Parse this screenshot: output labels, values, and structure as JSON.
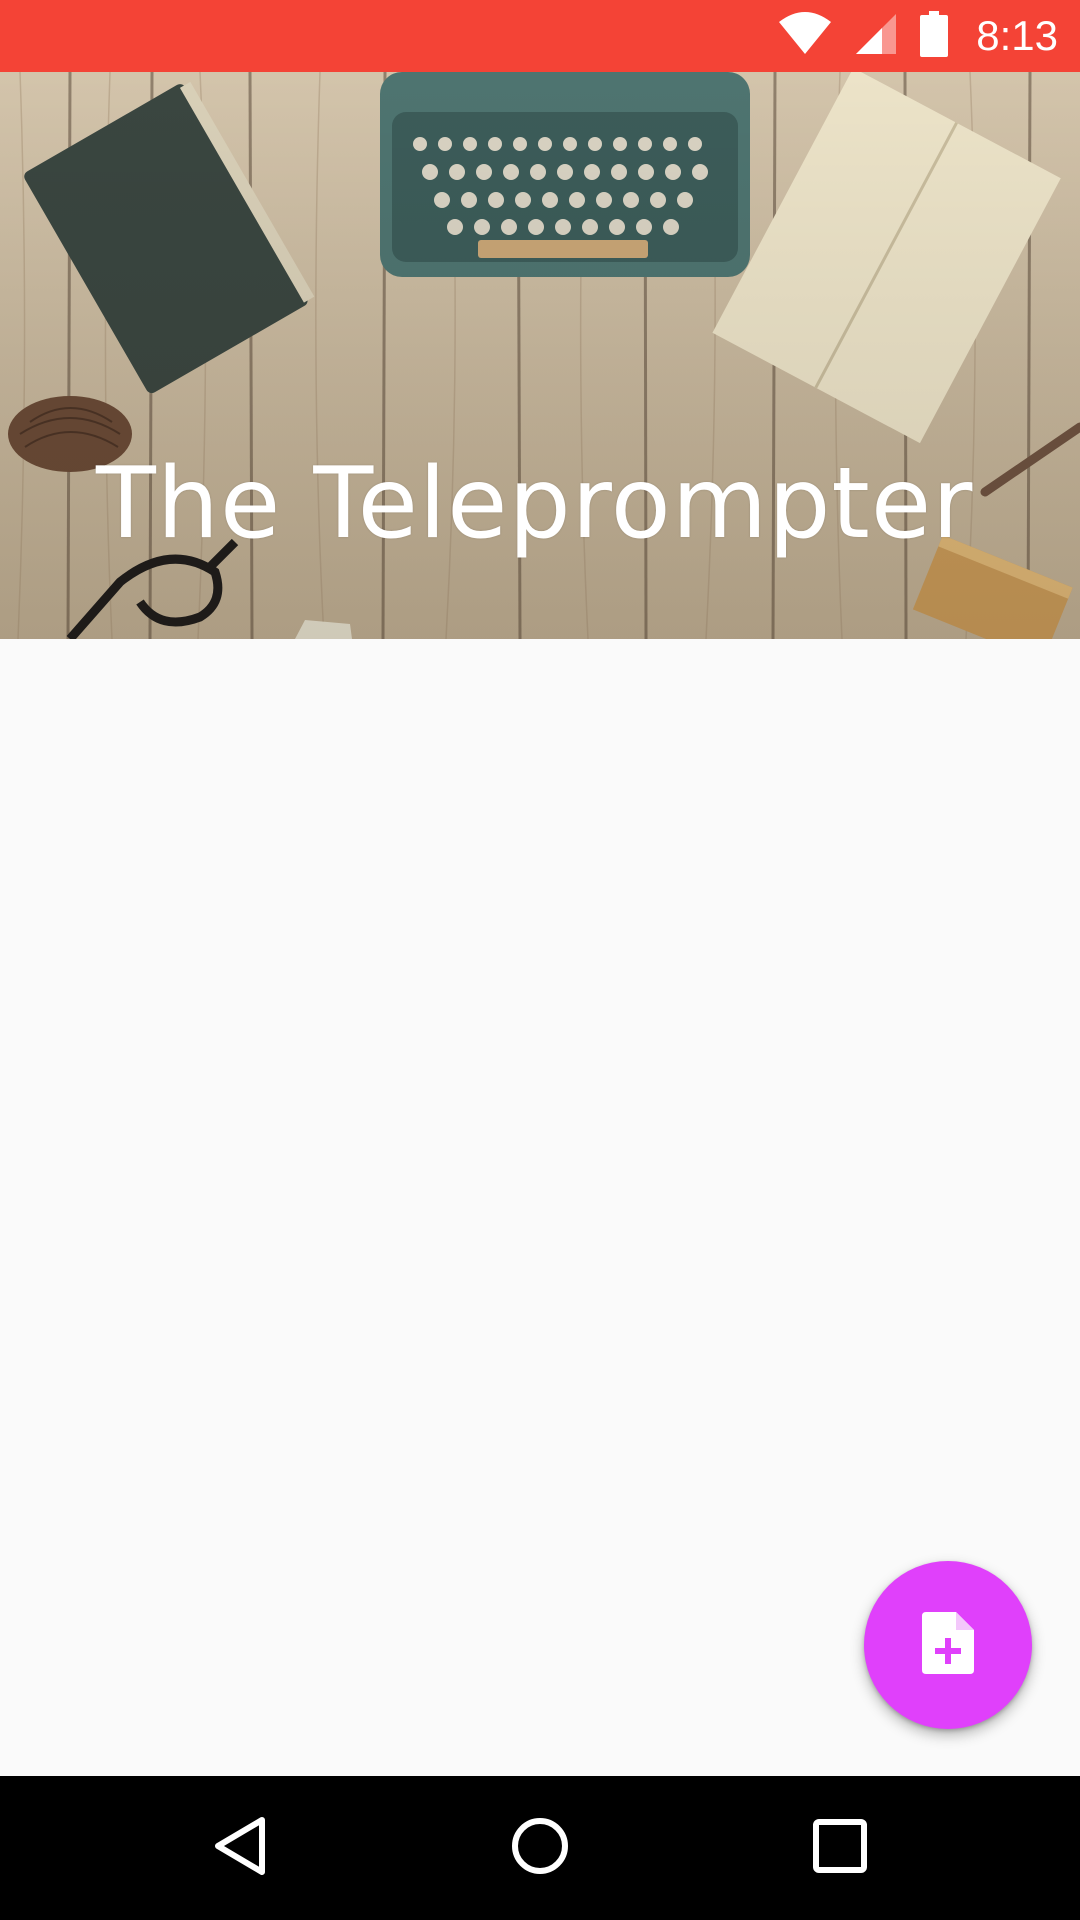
{
  "status_bar": {
    "time": "8:13",
    "background_color": "#f44336",
    "icons": [
      "wifi-icon",
      "cell-signal-icon",
      "battery-icon"
    ]
  },
  "header": {
    "title": "The Teleprompter",
    "background_image": "wooden-desk-typewriter-notebook-image"
  },
  "fab": {
    "icon": "note-add-icon",
    "color": "#e040fb"
  },
  "nav_bar": {
    "buttons": [
      "back-icon",
      "home-icon",
      "recents-icon"
    ]
  }
}
